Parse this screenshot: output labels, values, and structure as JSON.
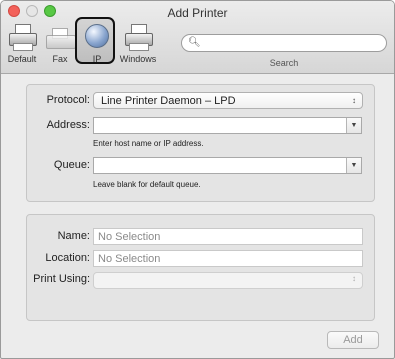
{
  "window": {
    "title": "Add Printer"
  },
  "toolbar": {
    "items": [
      {
        "label": "Default",
        "icon": "printer-icon"
      },
      {
        "label": "Fax",
        "icon": "fax-icon"
      },
      {
        "label": "IP",
        "icon": "globe-icon",
        "selected": true
      },
      {
        "label": "Windows",
        "icon": "printer-icon"
      }
    ],
    "search_label": "Search",
    "search_value": ""
  },
  "connection": {
    "protocol_label": "Protocol:",
    "protocol_value": "Line Printer Daemon – LPD",
    "address_label": "Address:",
    "address_value": "",
    "address_hint": "Enter host name or IP address.",
    "queue_label": "Queue:",
    "queue_value": "",
    "queue_hint": "Leave blank for default queue."
  },
  "details": {
    "name_label": "Name:",
    "name_placeholder": "No Selection",
    "location_label": "Location:",
    "location_placeholder": "No Selection",
    "print_using_label": "Print Using:",
    "print_using_value": ""
  },
  "actions": {
    "add_label": "Add",
    "add_enabled": false
  },
  "colors": {
    "close": "#f3615a",
    "maximize": "#58c845",
    "window_bg": "#ececec"
  }
}
